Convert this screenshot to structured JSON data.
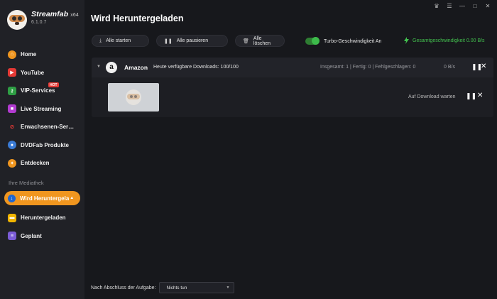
{
  "app": {
    "name": "Streamfab",
    "arch": "x64",
    "version": "6.1.0.7"
  },
  "sidebar": {
    "items": [
      {
        "label": "Home",
        "icon": "home-icon",
        "color": "#f0961f"
      },
      {
        "label": "YouTube",
        "icon": "youtube-icon",
        "color": "#e53935"
      },
      {
        "label": "VIP-Services",
        "icon": "key-icon",
        "color": "#2e9e44",
        "badge": "HOT"
      },
      {
        "label": "Live Streaming",
        "icon": "video-camera-icon",
        "color": "#b23bd0"
      },
      {
        "label": "Erwachsenen-Ser…",
        "icon": "adult-icon",
        "color": "#e53935"
      },
      {
        "label": "DVDFab Produkte",
        "icon": "dvdfab-icon",
        "color": "#3a7bd5"
      },
      {
        "label": "Entdecken",
        "icon": "compass-icon",
        "color": "#f0961f"
      }
    ],
    "library_label": "Ihre Mediathek",
    "library": [
      {
        "label": "Wird Heruntergela",
        "icon": "download-icon",
        "color": "#1f66d1",
        "active": true
      },
      {
        "label": "Heruntergeladen",
        "icon": "folder-icon",
        "color": "#f0b400"
      },
      {
        "label": "Geplant",
        "icon": "calendar-list-icon",
        "color": "#7b5cd6"
      }
    ]
  },
  "main": {
    "title": "Wird Heruntergeladen",
    "toolbar": {
      "start_all": "Alle starten",
      "pause_all": "Alle pausieren",
      "delete_all": "Alle löschen"
    },
    "turbo_label": "Turbo-Geschwindigkeit An",
    "turbo_on": true,
    "total_speed": "Gesamtgeschwindigkeit 0.00 B/s",
    "group": {
      "service": "Amazon",
      "quota": "Heute verfügbare Downloads: 100/100",
      "stats": "Insgesamt: 1 | Fertig: 0 | Fehlgeschlagen: 0",
      "speed": "0 B/s"
    },
    "task": {
      "status": "Auf Download warten"
    },
    "footer": {
      "label": "Nach Abschluss der Aufgabe:",
      "selected": "Nichts tun"
    }
  },
  "colors": {
    "accent": "#f0961f",
    "success": "#43c24f",
    "background": "#17181c",
    "sidebar": "#202126"
  }
}
